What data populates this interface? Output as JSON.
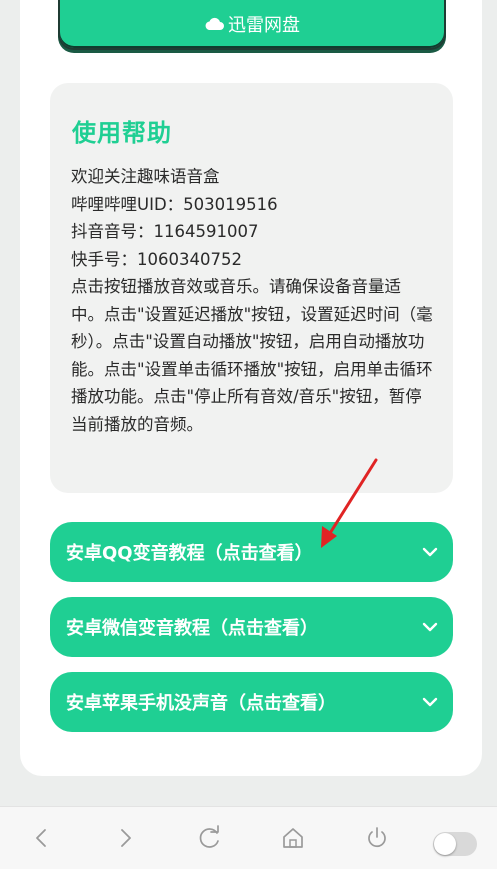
{
  "top_button": {
    "label": "迅雷网盘",
    "icon": "cloud-icon"
  },
  "help": {
    "title": "使用帮助",
    "lines": [
      "欢迎关注趣味语音盒",
      "哔哩哔哩UID：503019516",
      "抖音音号：1164591007",
      "快手号：1060340752",
      "点击按钮播放音效或音乐。请确保设备音量适中。点击\"设置延迟播放\"按钮，设置延迟时间（毫秒）。点击\"设置自动播放\"按钮，启用自动播放功能。点击\"设置单击循环播放\"按钮，启用单击循环播放功能。点击\"停止所有音效/音乐\"按钮，暂停当前播放的音频。"
    ]
  },
  "accordions": [
    {
      "label": "安卓QQ变音教程（点击查看）"
    },
    {
      "label": "安卓微信变音教程（点击查看）"
    },
    {
      "label": "安卓苹果手机没声音（点击查看）"
    }
  ],
  "colors": {
    "accent": "#1fcf93",
    "annotation_arrow": "#e02424"
  },
  "browser_bar": {
    "icons": [
      "back-icon",
      "forward-icon",
      "refresh-icon",
      "home-icon",
      "power-icon",
      "toggle-switch"
    ],
    "toggle_on": false
  }
}
